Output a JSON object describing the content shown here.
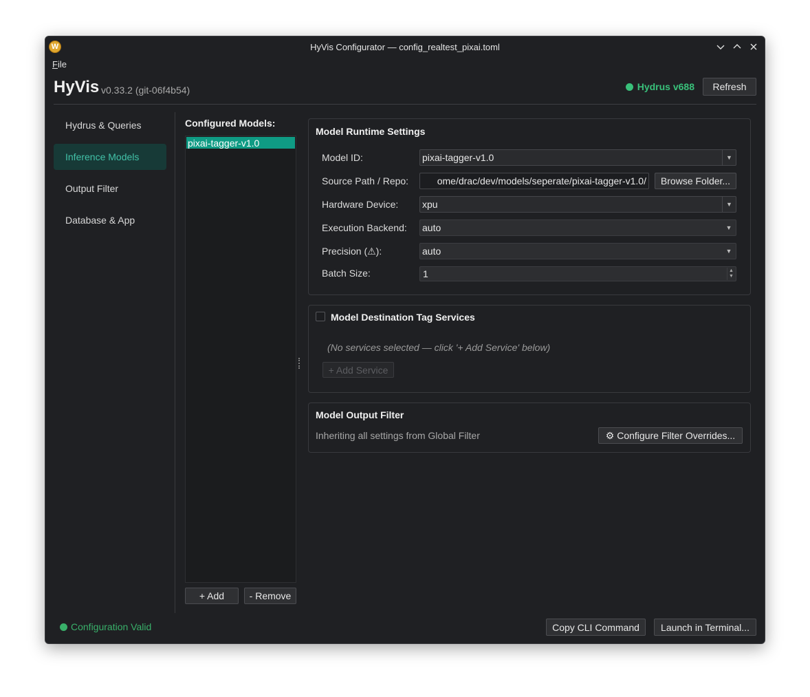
{
  "window": {
    "title": "HyVis Configurator — config_realtest_pixai.toml",
    "icon_letter": "W",
    "controls": [
      "minimize-icon",
      "maximize-icon",
      "close-icon"
    ]
  },
  "menubar": {
    "file_underlined": "F",
    "file_rest": "ile"
  },
  "header": {
    "app_name": "HyVis",
    "version": "v0.33.2 (git-06f4b54)",
    "hydrus_status": "Hydrus v688",
    "refresh_label": "Refresh"
  },
  "sidebar": {
    "items": [
      {
        "label": "Hydrus & Queries",
        "active": false
      },
      {
        "label": "Inference Models",
        "active": true
      },
      {
        "label": "Output Filter",
        "active": false
      },
      {
        "label": "Database & App",
        "active": false
      }
    ]
  },
  "models": {
    "title": "Configured Models:",
    "list": [
      "pixai-tagger-v1.0"
    ],
    "add_label": "+ Add",
    "remove_label": "- Remove"
  },
  "runtime": {
    "title": "Model Runtime Settings",
    "model_id_label": "Model ID:",
    "model_id_value": "pixai-tagger-v1.0",
    "source_label": "Source Path / Repo:",
    "source_value": "ome/drac/dev/models/seperate/pixai-tagger-v1.0/",
    "browse_label": "Browse Folder...",
    "device_label": "Hardware Device:",
    "device_value": "xpu",
    "backend_label": "Execution Backend:",
    "backend_value": "auto",
    "precision_label": "Precision (⚠):",
    "precision_value": "auto",
    "batch_label": "Batch Size:",
    "batch_value": "1"
  },
  "destination": {
    "title": "Model Destination Tag Services",
    "checked": false,
    "placeholder": "(No services selected — click '+ Add Service' below)",
    "add_service_label": "+ Add Service"
  },
  "output_filter": {
    "title": "Model Output Filter",
    "inherit_text": "Inheriting all settings from Global Filter",
    "configure_label": "⚙ Configure Filter Overrides..."
  },
  "footer": {
    "status": "Configuration Valid",
    "copy_label": "Copy CLI Command",
    "launch_label": "Launch in Terminal..."
  },
  "colors": {
    "accent": "#0f9b84",
    "active_nav_bg": "#173a37",
    "active_nav_text": "#42c2a8",
    "status_green": "#39c07a",
    "window_bg": "#1f2023"
  }
}
